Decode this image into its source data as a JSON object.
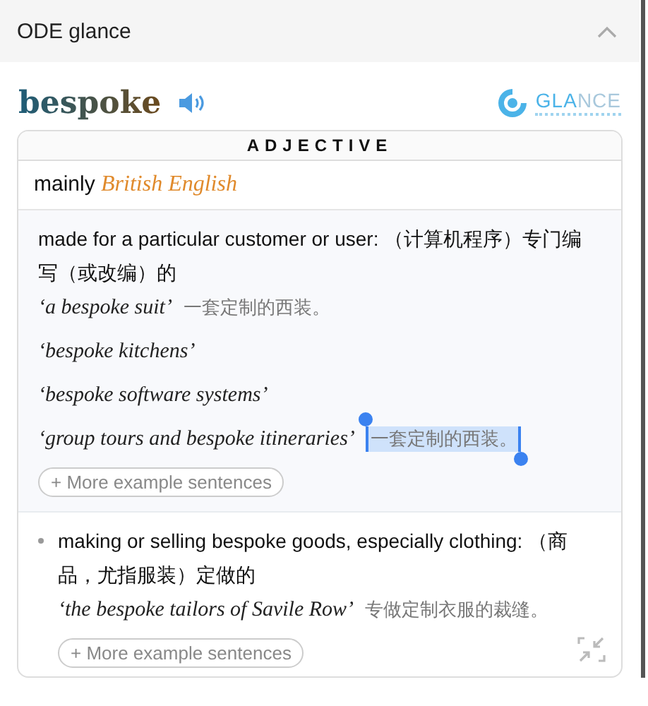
{
  "panel": {
    "title": "ODE glance",
    "expanded": true
  },
  "entry": {
    "headword": "bespoke",
    "logo": [
      "GLA",
      "NCE"
    ]
  },
  "part_of_speech": "ADJECTIVE",
  "usage": {
    "label": "mainly",
    "region": "British English"
  },
  "senses": [
    {
      "kind": "main",
      "definition": "made for a particular customer or user: （计算机程序）专门编写（或改编）的",
      "examples": [
        {
          "text": "‘a bespoke suit’",
          "translation": "一套定制的西装。",
          "selected": false
        },
        {
          "text": "‘bespoke kitchens’",
          "selected": false
        },
        {
          "text": "‘bespoke software systems’",
          "selected": false
        },
        {
          "text": "‘group tours and bespoke itineraries’",
          "translation": "一套定制的西装。",
          "selected": true
        }
      ],
      "more": "+ More example sentences"
    },
    {
      "kind": "sub",
      "definition": "making or selling bespoke goods, especially clothing: （商品，尤指服装）定做的",
      "examples": [
        {
          "text": "‘the bespoke tailors of Savile Row’",
          "translation": "专做定制衣服的裁缝。",
          "selected": false
        }
      ],
      "more": "+ More example sentences"
    }
  ]
}
